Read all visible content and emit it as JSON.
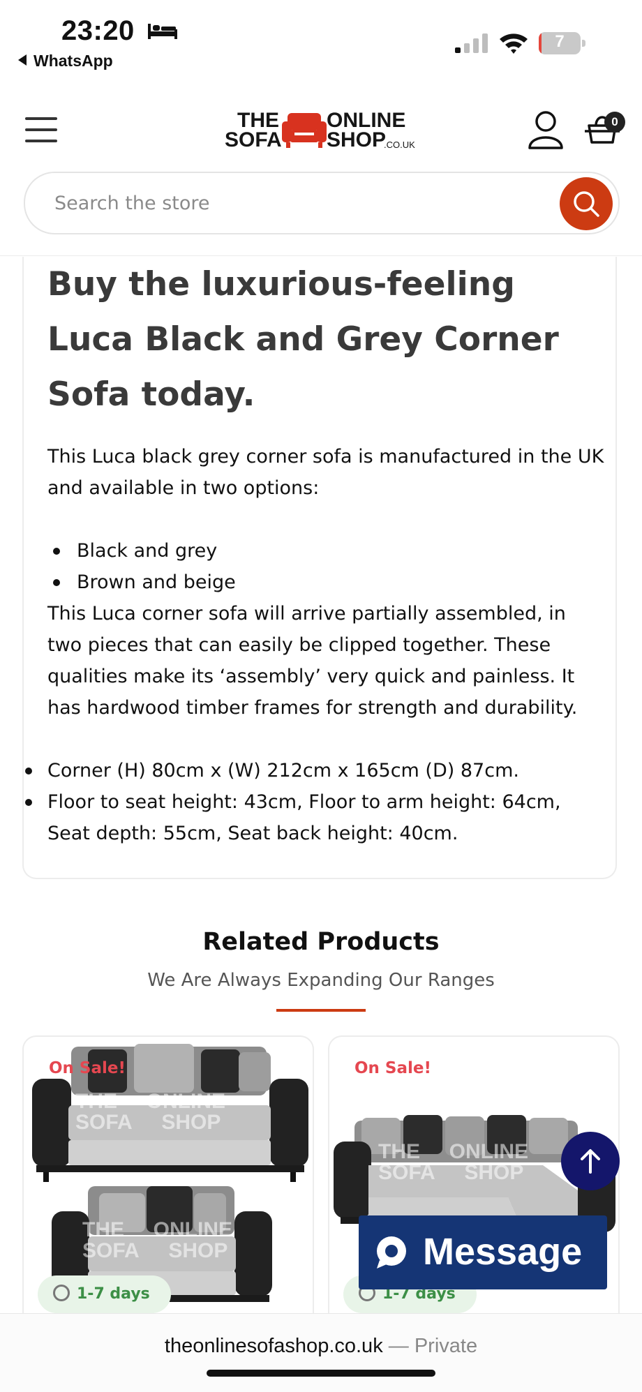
{
  "status_bar": {
    "time": "23:20",
    "back_app": "WhatsApp",
    "battery_level": "7",
    "battery_color": "#e5463b"
  },
  "header": {
    "logo": {
      "line1_left": "THE",
      "line1_right": "ONLINE",
      "line2_left": "SOFA",
      "line2_right": "SHOP",
      "suffix": ".CO.UK"
    },
    "cart_count": "0",
    "search_placeholder": "Search the store",
    "accent_color": "#cc3b12"
  },
  "description": {
    "title": "Buy the luxurious-feeling Luca Black and Grey Corner Sofa today.",
    "intro": "This Luca black grey corner sofa is manufactured in the UK and available in two options:",
    "options": [
      "Black and grey",
      "Brown and beige"
    ],
    "assembly": "This Luca corner sofa will arrive partially assembled, in two pieces that can easily be clipped together. These qualities make its ‘assembly’ very quick and painless. It has hardwood timber frames for strength and durability.",
    "dimensions": [
      "Corner (H) 80cm x (W) 212cm x 165cm (D) 87cm.",
      "Floor to seat height: 43cm, Floor to arm height: 64cm, Seat depth: 55cm, Seat back height: 40cm."
    ]
  },
  "related": {
    "title": "Related Products",
    "subtitle": "We Are Always Expanding Our Ranges",
    "products": [
      {
        "badge": "On Sale!",
        "delivery": "1-7 days",
        "image": "black-grey-sofa-set-image"
      },
      {
        "badge": "On Sale!",
        "delivery": "1-7 days",
        "image": "black-grey-corner-sofa-image"
      }
    ]
  },
  "widgets": {
    "message_label": "Message",
    "scroll_top_icon": "arrow-up-icon"
  },
  "browser": {
    "domain": "theonlinesofashop.co.uk",
    "privacy": " — Private"
  }
}
